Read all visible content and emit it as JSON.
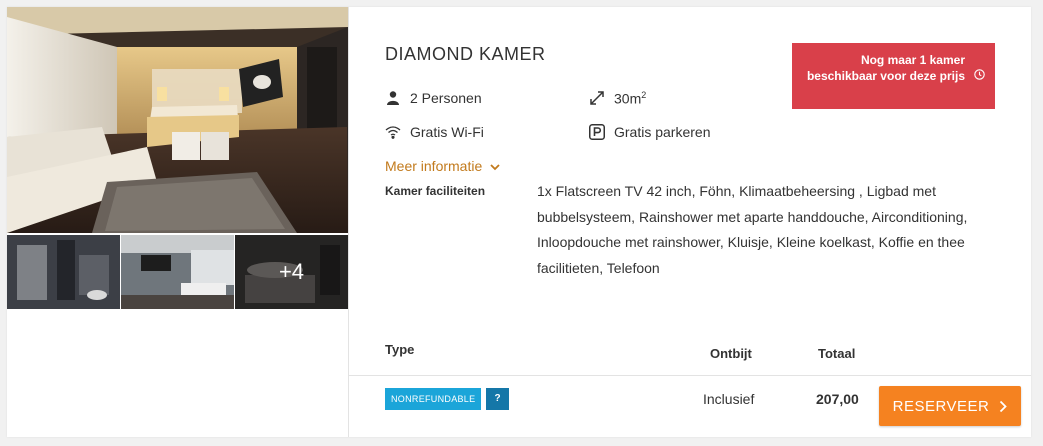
{
  "room": {
    "name": "DIAMOND KAMER",
    "features": {
      "persons": "2 Personen",
      "size": "30m",
      "size_sup": "2",
      "wifi": "Gratis Wi-Fi",
      "parking": "Gratis parkeren"
    },
    "availability": "Nog maar 1 kamer beschikbaar voor deze prijs",
    "more_info": "Meer informatie",
    "facilities_label": "Kamer faciliteiten",
    "facilities_text": "1x Flatscreen TV 42 inch, Föhn, Klimaatbeheersing , Ligbad met bubbelsysteem, Rainshower met aparte handdouche, Airconditioning, Inloopdouche met rainshower, Kluisje, Kleine koelkast, Koffie en thee facilitieten, Telefoon"
  },
  "gallery": {
    "more_count": "+4"
  },
  "rates": {
    "headers": {
      "type": "Type",
      "breakfast": "Ontbijt",
      "total": "Totaal"
    },
    "rows": [
      {
        "badge": "NONREFUNDABLE",
        "help": "?",
        "breakfast": "Inclusief",
        "total": "207,00",
        "button": "RESERVEER"
      }
    ]
  },
  "colors": {
    "availability_bg": "#d9404a",
    "link": "#c27a1c",
    "badge": "#1ba5d9",
    "badge_help": "#1577a8",
    "reserve": "#f58220"
  }
}
